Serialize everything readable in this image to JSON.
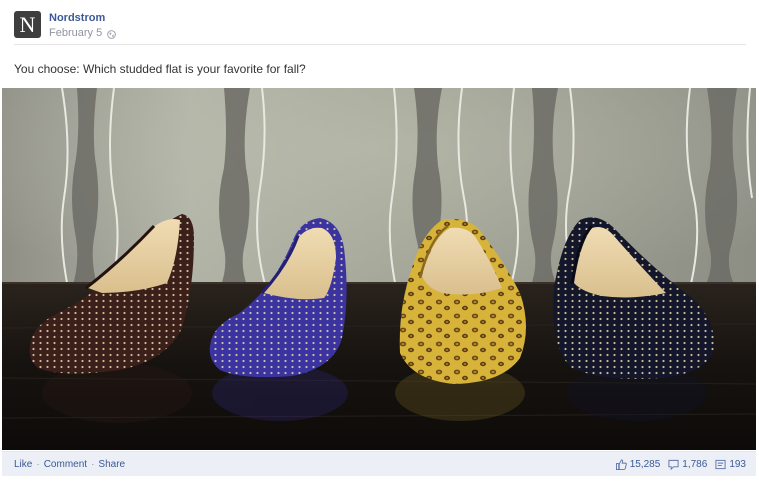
{
  "post": {
    "page_name": "Nordstrom",
    "avatar_letter": "N",
    "date": "February 5",
    "privacy_icon": "globe-icon",
    "message": "You choose: Which studded flat is your favorite for fall?"
  },
  "photo": {
    "shoes": [
      {
        "color": "brown suede",
        "body": "#3a1f1b"
      },
      {
        "color": "purple suede",
        "body": "#3b34a0"
      },
      {
        "color": "leopard print",
        "body": "#d9b43c"
      },
      {
        "color": "navy suede",
        "body": "#14162b"
      }
    ]
  },
  "footer": {
    "like": "Like",
    "comment": "Comment",
    "share": "Share",
    "separator": "·",
    "likes_count": "15,285",
    "comments_count": "1,786",
    "shares_count": "193"
  },
  "colors": {
    "link": "#3b5998",
    "footer_bg": "#eceff5"
  }
}
